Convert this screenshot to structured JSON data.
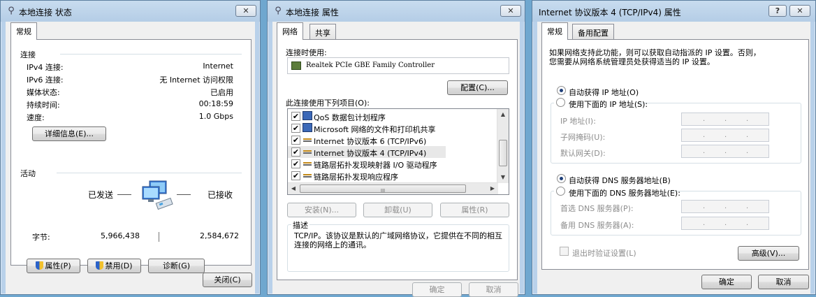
{
  "win1": {
    "title": "本地连接 状态",
    "close_glyph": "✕",
    "tab_general": "常规",
    "connection_heading": "连接",
    "rows": [
      {
        "label": "IPv4 连接:",
        "value": "Internet"
      },
      {
        "label": "IPv6 连接:",
        "value": "无 Internet 访问权限"
      },
      {
        "label": "媒体状态:",
        "value": "已启用"
      },
      {
        "label": "持续时间:",
        "value": "00:18:59"
      },
      {
        "label": "速度:",
        "value": "1.0 Gbps"
      }
    ],
    "details_button": "详细信息(E)...",
    "activity_heading": "活动",
    "sent_label": "已发送",
    "received_label": "已接收",
    "bytes_label": "字节:",
    "bytes_sent": "5,966,438",
    "bytes_received": "2,584,672",
    "properties_button": "属性(P)",
    "disable_button": "禁用(D)",
    "diagnose_button": "诊断(G)",
    "close_button": "关闭(C)"
  },
  "win2": {
    "title": "本地连接 属性",
    "close_glyph": "✕",
    "tab_network": "网络",
    "tab_sharing": "共享",
    "connect_using_label": "连接时使用:",
    "adapter_name": "Realtek PCIe GBE Family Controller",
    "configure_button": "配置(C)...",
    "items_label": "此连接使用下列项目(O):",
    "items": [
      {
        "label": "QoS 数据包计划程序",
        "checked": "✔",
        "icon": "network-client-icon"
      },
      {
        "label": "Microsoft 网络的文件和打印机共享",
        "checked": "✔",
        "icon": "network-client-icon"
      },
      {
        "label": "Internet 协议版本 6 (TCP/IPv6)",
        "checked": "✔",
        "icon": "protocol-icon"
      },
      {
        "label": "Internet 协议版本 4 (TCP/IPv4)",
        "checked": "✔",
        "icon": "protocol-icon"
      },
      {
        "label": "链路层拓扑发现映射器 I/O 驱动程序",
        "checked": "✔",
        "icon": "protocol-icon"
      },
      {
        "label": "链路层拓扑发现响应程序",
        "checked": "✔",
        "icon": "protocol-icon"
      }
    ],
    "scroll_left": "◀",
    "scroll_right": "▶",
    "scroll_up": "▲",
    "scroll_down": "▼",
    "scroll_grip": "III",
    "install_button": "安装(N)...",
    "uninstall_button": "卸载(U)",
    "properties_button": "属性(R)",
    "description_heading": "描述",
    "description_text": "TCP/IP。该协议是默认的广域网络协议，它提供在不同的相互连接的网络上的通讯。",
    "ok_button": "确定",
    "cancel_button": "取消"
  },
  "win3": {
    "title": "Internet 协议版本 4 (TCP/IPv4) 属性",
    "help_glyph": "?",
    "close_glyph": "✕",
    "tab_general": "常规",
    "tab_alternate": "备用配置",
    "intro_line1": "如果网络支持此功能，则可以获取自动指派的 IP 设置。否则，",
    "intro_line2": "您需要从网络系统管理员处获得适当的 IP 设置。",
    "auto_ip_label": "自动获得 IP 地址(O)",
    "manual_ip_label": "使用下面的 IP 地址(S):",
    "ip_address_label": "IP 地址(I):",
    "subnet_label": "子网掩码(U):",
    "gateway_label": "默认网关(D):",
    "auto_dns_label": "自动获得 DNS 服务器地址(B)",
    "manual_dns_label": "使用下面的 DNS 服务器地址(E):",
    "preferred_dns_label": "首选 DNS 服务器(P):",
    "alternate_dns_label": "备用 DNS 服务器(A):",
    "validate_label": "退出时验证设置(L)",
    "advanced_button": "高级(V)...",
    "ok_button": "确定",
    "cancel_button": "取消",
    "ip_dot": "."
  }
}
